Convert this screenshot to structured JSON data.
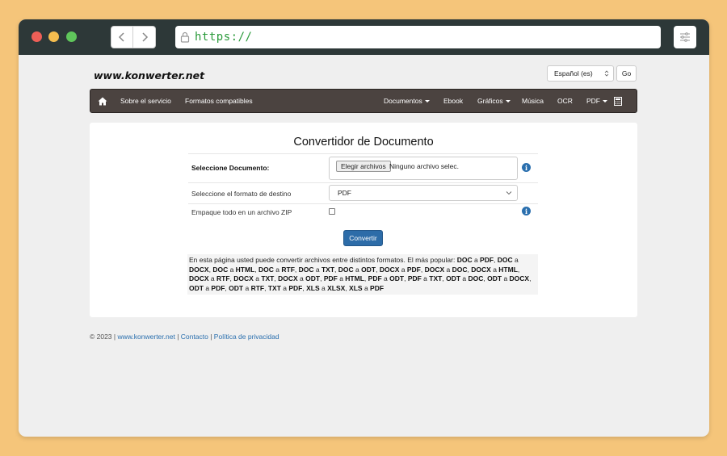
{
  "browser": {
    "url": "https://"
  },
  "site": {
    "logo": "www.konwerter.net",
    "language": "Español (es)",
    "go_label": "Go"
  },
  "nav": {
    "left": [
      "Sobre el servicio",
      "Formatos compatibles"
    ],
    "right": [
      {
        "label": "Documentos"
      },
      {
        "label": "Ebook"
      },
      {
        "label": "Gráficos"
      },
      {
        "label": "Música"
      },
      {
        "label": "OCR"
      },
      {
        "label": "PDF"
      }
    ]
  },
  "form": {
    "title": "Convertidor de Documento",
    "select_doc_label": "Seleccione Documento:",
    "file_button": "Elegir archivos",
    "file_status": "Ninguno archivo selec.",
    "target_format_label": "Seleccione el formato de destino",
    "target_format_value": "PDF",
    "zip_label": "Empaque todo en un archivo ZIP",
    "convert_label": "Convertir"
  },
  "description": {
    "intro": "En esta página usted puede convertir archivos entre distintos formatos. El más popular:",
    "connector": "a",
    "pairs": [
      [
        "DOC",
        "PDF"
      ],
      [
        "DOC",
        "DOCX"
      ],
      [
        "DOC",
        "HTML"
      ],
      [
        "DOC",
        "RTF"
      ],
      [
        "DOC",
        "TXT"
      ],
      [
        "DOC",
        "ODT"
      ],
      [
        "DOCX",
        "PDF"
      ],
      [
        "DOCX",
        "DOC"
      ],
      [
        "DOCX",
        "HTML"
      ],
      [
        "DOCX",
        "RTF"
      ],
      [
        "DOCX",
        "TXT"
      ],
      [
        "DOCX",
        "ODT"
      ],
      [
        "PDF",
        "HTML"
      ],
      [
        "PDF",
        "ODT"
      ],
      [
        "PDF",
        "TXT"
      ],
      [
        "ODT",
        "DOC"
      ],
      [
        "ODT",
        "DOCX"
      ],
      [
        "ODT",
        "PDF"
      ],
      [
        "ODT",
        "RTF"
      ],
      [
        "TXT",
        "PDF"
      ],
      [
        "XLS",
        "XLSX"
      ],
      [
        "XLS",
        "PDF"
      ]
    ]
  },
  "footer": {
    "copyright": "© 2023 |",
    "links": [
      "www.konwerter.net",
      "Contacto",
      "Política de privacidad"
    ],
    "separator": "|"
  },
  "icons": {
    "home": "home-icon",
    "calculator": "calculator-icon",
    "info": "info-icon"
  }
}
